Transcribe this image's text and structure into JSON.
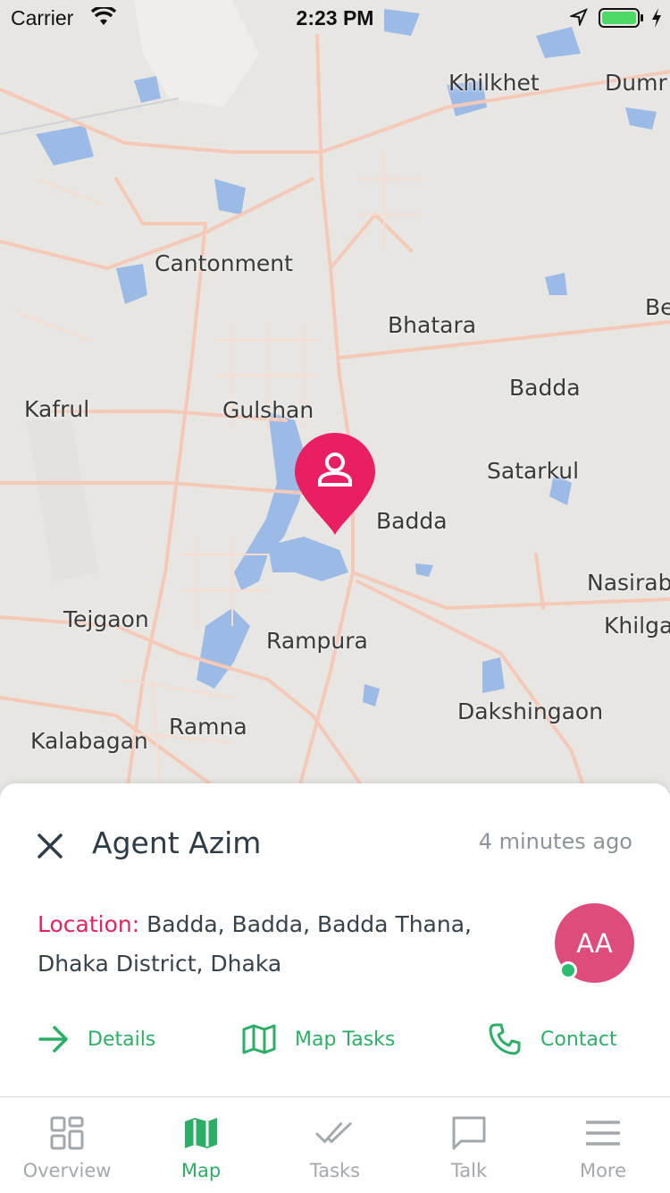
{
  "status_bar": {
    "carrier": "Carrier",
    "time": "2:23 PM"
  },
  "map": {
    "labels": [
      "Khilkhet",
      "Dumr",
      "Cantonment",
      "Bhatara",
      "Be",
      "Badda",
      "Kafrul",
      "Gulshan",
      "Satarkul",
      "Badda",
      "Nasirab",
      "Khilga",
      "Tejgaon",
      "Rampura",
      "Dakshingaon",
      "Kalabagan",
      "Ramna"
    ],
    "marker_icon": "person-icon",
    "marker_color": "#e91e63"
  },
  "sheet": {
    "agent_name": "Agent Azim",
    "time_ago": "4 minutes ago",
    "location_label": "Location:",
    "location_value": "Badda, Badda, Badda Thana, Dhaka District, Dhaka",
    "avatar_initials": "AA",
    "avatar_color": "#de4c7c",
    "online_color": "#2dbd71",
    "actions": [
      {
        "label": "Details",
        "icon": "arrow-right-icon"
      },
      {
        "label": "Map Tasks",
        "icon": "map-icon"
      },
      {
        "label": "Contact",
        "icon": "phone-icon"
      }
    ]
  },
  "tabbar": {
    "active": "Map",
    "accent": "#2cae66",
    "tabs": [
      {
        "label": "Overview",
        "icon": "grid-icon"
      },
      {
        "label": "Map",
        "icon": "map-icon"
      },
      {
        "label": "Tasks",
        "icon": "double-check-icon"
      },
      {
        "label": "Talk",
        "icon": "chat-icon"
      },
      {
        "label": "More",
        "icon": "menu-icon"
      }
    ]
  }
}
